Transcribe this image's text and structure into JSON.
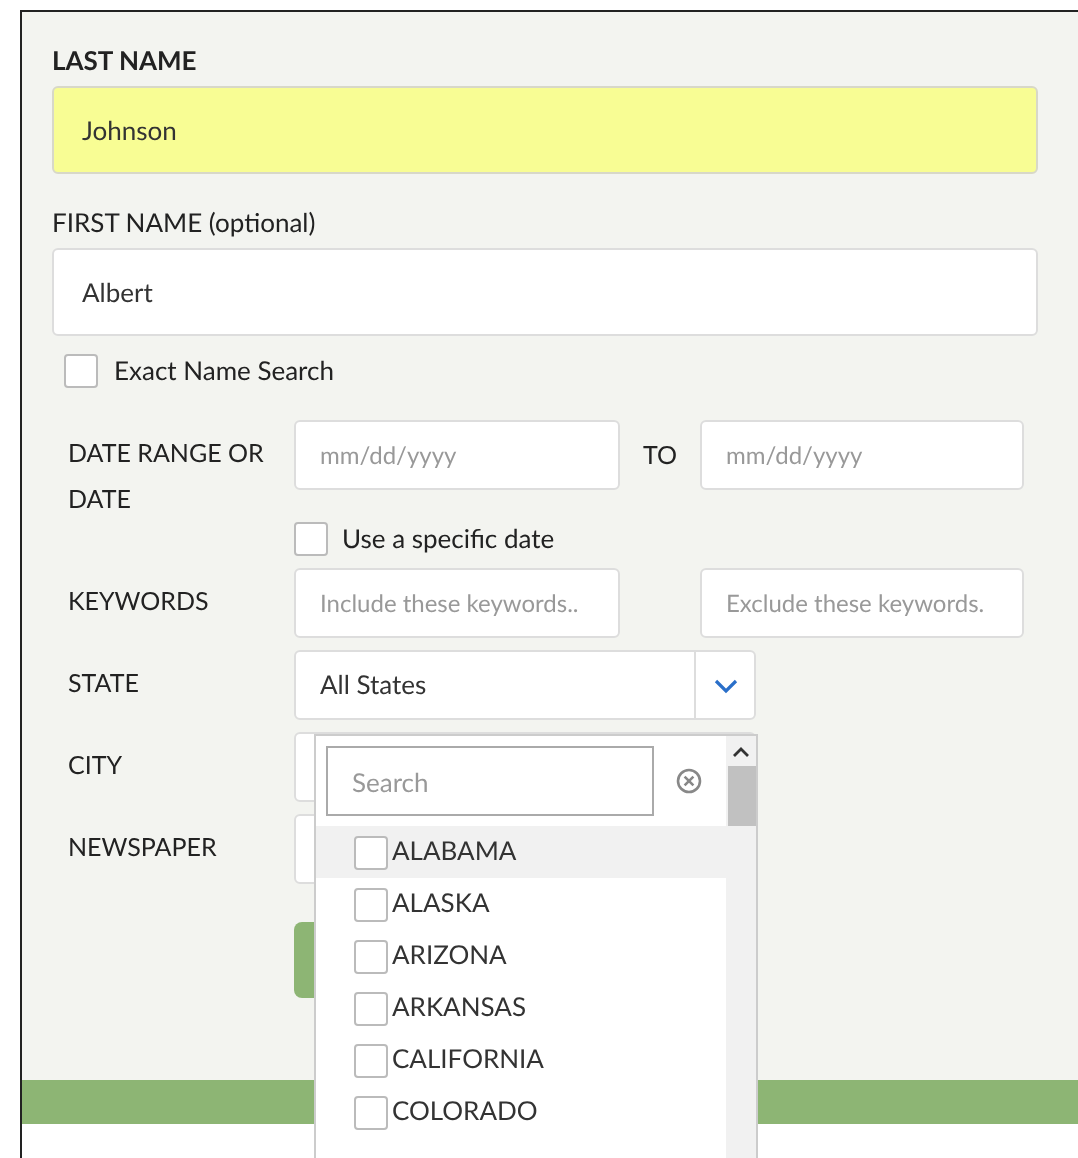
{
  "last_name": {
    "label": "LAST NAME",
    "value": "Johnson"
  },
  "first_name": {
    "label": "FIRST NAME (optional)",
    "value": "Albert"
  },
  "exact_name": {
    "label": "Exact Name Search",
    "checked": false
  },
  "date_range": {
    "label": "DATE RANGE OR DATE",
    "from_placeholder": "mm/dd/yyyy",
    "to_label": "TO",
    "to_placeholder": "mm/dd/yyyy"
  },
  "specific_date": {
    "label": "Use a specific date",
    "checked": false
  },
  "keywords": {
    "label": "KEYWORDS",
    "include_placeholder": "Include these keywords..",
    "exclude_placeholder": "Exclude these keywords."
  },
  "state": {
    "label": "STATE",
    "value": "All States"
  },
  "city": {
    "label": "CITY"
  },
  "newspaper": {
    "label": "NEWSPAPER"
  },
  "state_dropdown": {
    "search_placeholder": "Search",
    "options": [
      {
        "label": "ALABAMA",
        "checked": false,
        "selected": true
      },
      {
        "label": "ALASKA",
        "checked": false,
        "selected": false
      },
      {
        "label": "ARIZONA",
        "checked": false,
        "selected": false
      },
      {
        "label": "ARKANSAS",
        "checked": false,
        "selected": false
      },
      {
        "label": "CALIFORNIA",
        "checked": false,
        "selected": false
      },
      {
        "label": "COLORADO",
        "checked": false,
        "selected": false
      }
    ]
  }
}
